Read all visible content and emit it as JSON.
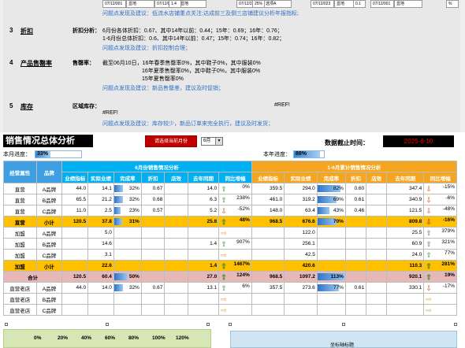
{
  "top": {
    "mini_cells": [
      "07/12/001",
      "显地",
      "07/12/001",
      "显地",
      "07/12/23",
      "选项A",
      "07/12/023",
      "显地",
      "07/12/001",
      "显地"
    ],
    "mini_vals": [
      "1.4",
      "25%",
      "0.1",
      "%"
    ],
    "note0": "问题点发现及建议：低流水店铺重点关注;达成前三及倒三店铺建议分析年报指标;",
    "items": [
      {
        "num": "3",
        "title": "折扣",
        "label": "折扣分析：",
        "lines": [
          "6月份各体折扣：0.67、其中14年以前：0.44；15年：0.69；16年：0.76；",
          "1-6月份总体折扣：0.6、其中14年以前：0.47；15年：0.74；16年：0.82；"
        ],
        "note": "问题点发现及建议：折扣控制合理；"
      },
      {
        "num": "4",
        "title": "产品售罄率",
        "label": "售罄率：",
        "lines": [
          "截至06月10日，16年春季售罄率0%，其中鞋子0%，其中服装0%",
          "16年夏季售罄率0%，其中鞋子0%，其中服装0%",
          "15年夏售罄率0%"
        ],
        "note": "问题点发现及建议：新品售罄差，建议及时促销；"
      },
      {
        "num": "5",
        "title": "库存",
        "label": "区域库存：",
        "ref1": "#REF!",
        "ref2": "#REF!",
        "note": "问题点发现及建议：库存较少，新品订单来完全执行，建议及时发货；"
      }
    ]
  },
  "header": {
    "title": "销售情况总体分析",
    "select_btn": "请选择当前月份",
    "month": "6月",
    "date_label": "数据截止时间：",
    "date": "2025-6-10",
    "progress_label": "本月进度：",
    "progress": "33%",
    "progress_value": 0.33,
    "year_label": "本年进度：",
    "year_progress": "88%",
    "year_progress_value": 0.88
  },
  "table": {
    "h_group1": "6月份销售情况分析",
    "h_group2": "1-6月累计销售情况分析",
    "h_attr": "经营属性",
    "h_brand": "品牌",
    "cols": [
      "业绩指标",
      "实际业绩",
      "完成率",
      "折扣",
      "店效",
      "去年同期",
      "同比增幅"
    ],
    "cols2": [
      "业绩指标",
      "实际业绩",
      "完成率",
      "折扣",
      "店效",
      "去年同期",
      "同比增幅"
    ],
    "rows": [
      {
        "type": "n",
        "attr": "直营",
        "brand": "A品牌",
        "m": [
          "44.0",
          "14.1",
          "32%",
          "0.67",
          "",
          "14.0",
          "0%"
        ],
        "mr": 0.32,
        "ma": "up",
        "y": [
          "359.5",
          "294.0",
          "82%",
          "0.60",
          "",
          "347.4",
          "-15%"
        ],
        "yr": 0.82,
        "ya": "dn"
      },
      {
        "type": "n",
        "attr": "直营",
        "brand": "B品牌",
        "m": [
          "65.5",
          "21.2",
          "32%",
          "0.68",
          "",
          "6.3",
          "238%"
        ],
        "mr": 0.32,
        "ma": "up",
        "y": [
          "461.0",
          "319.2",
          "69%",
          "0.61",
          "",
          "340.9",
          "-6%"
        ],
        "yr": 0.69,
        "ya": "dn"
      },
      {
        "type": "n",
        "attr": "直营",
        "brand": "C品牌",
        "m": [
          "11.0",
          "2.5",
          "23%",
          "0.57",
          "",
          "5.2",
          "-52%"
        ],
        "mr": 0.23,
        "ma": "dn",
        "y": [
          "148.0",
          "63.4",
          "43%",
          "0.46",
          "",
          "121.5",
          "-48%"
        ],
        "yr": 0.43,
        "ya": "dn"
      },
      {
        "type": "y",
        "attr": "直营",
        "brand": "小计",
        "m": [
          "120.5",
          "37.8",
          "31%",
          "",
          "",
          "25.6",
          "48%"
        ],
        "mr": 0.31,
        "ma": "up",
        "y": [
          "968.5",
          "676.6",
          "70%",
          "",
          "",
          "809.8",
          "-16%"
        ],
        "yr": 0.7,
        "ya": "dn"
      },
      {
        "type": "n",
        "attr": "加盟",
        "brand": "A品牌",
        "m": [
          "",
          "5.0",
          "",
          "",
          "",
          "",
          ""
        ],
        "mr": 0,
        "ma": "fl",
        "y": [
          "",
          "122.0",
          "",
          "",
          "",
          "25.5",
          "379%"
        ],
        "yr": 0,
        "ya": "up"
      },
      {
        "type": "n",
        "attr": "加盟",
        "brand": "B品牌",
        "m": [
          "",
          "14.6",
          "",
          "",
          "",
          "1.4",
          "907%"
        ],
        "mr": 0,
        "ma": "up",
        "y": [
          "",
          "256.1",
          "",
          "",
          "",
          "60.9",
          "321%"
        ],
        "yr": 0,
        "ya": "up"
      },
      {
        "type": "n",
        "attr": "加盟",
        "brand": "C品牌",
        "m": [
          "",
          "3.1",
          "",
          "",
          "",
          "",
          ""
        ],
        "mr": 0,
        "ma": "fl",
        "y": [
          "",
          "42.5",
          "",
          "",
          "",
          "24.0",
          "77%"
        ],
        "yr": 0,
        "ya": "up"
      },
      {
        "type": "y",
        "attr": "加盟",
        "brand": "小计",
        "m": [
          "",
          "22.6",
          "",
          "",
          "",
          "1.4",
          "1467%"
        ],
        "mr": 0,
        "ma": "up",
        "y": [
          "",
          "420.6",
          "",
          "",
          "",
          "110.3",
          "281%"
        ],
        "yr": 0,
        "ya": "up"
      },
      {
        "type": "p",
        "attr": "合计",
        "brand": "",
        "m": [
          "120.5",
          "60.4",
          "50%",
          "",
          "",
          "27.0",
          "124%"
        ],
        "mr": 0.5,
        "ma": "up",
        "y": [
          "968.5",
          "1097.2",
          "113%",
          "",
          "",
          "920.1",
          "19%"
        ],
        "yr": 1.0,
        "ya": "up"
      },
      {
        "type": "n",
        "attr": "直营老店",
        "brand": "A品牌",
        "m": [
          "44.0",
          "14.0",
          "32%",
          "0.67",
          "",
          "13.1",
          "6%"
        ],
        "mr": 0.32,
        "ma": "up",
        "y": [
          "357.5",
          "273.6",
          "77%",
          "0.61",
          "",
          "330.1",
          "-17%"
        ],
        "yr": 0.77,
        "ya": "dn"
      },
      {
        "type": "n",
        "attr": "直营老店",
        "brand": "B品牌",
        "m": [
          "",
          "",
          "",
          "",
          "",
          "",
          ""
        ],
        "mr": 0,
        "ma": "fl",
        "y": [
          "",
          "",
          "",
          "",
          "",
          "",
          ""
        ],
        "yr": 0,
        "ya": "fl"
      },
      {
        "type": "n",
        "attr": "直营老店",
        "brand": "C品牌",
        "m": [
          "",
          "",
          "",
          "",
          "",
          "",
          ""
        ],
        "mr": 0,
        "ma": "fl",
        "y": [
          "",
          "",
          "",
          "",
          "",
          "",
          ""
        ],
        "yr": 0,
        "ya": "fl"
      }
    ]
  },
  "bottom": {
    "axis_ticks": [
      "0%",
      "20%",
      "40%",
      "60%",
      "80%",
      "100%",
      "120%"
    ],
    "right_title": "坐标轴标题"
  }
}
